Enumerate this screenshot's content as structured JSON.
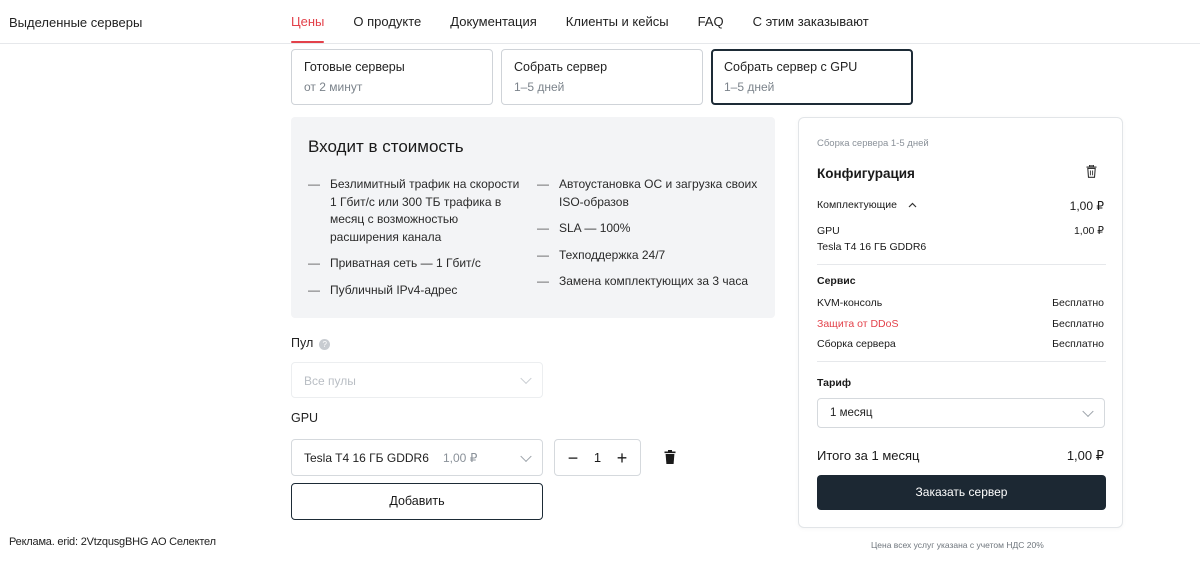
{
  "header": {
    "brand": "Выделенные серверы",
    "nav": [
      "Цены",
      "О продукте",
      "Документация",
      "Клиенты и кейсы",
      "FAQ",
      "С этим заказывают"
    ],
    "active_color": "#e3414a"
  },
  "server_types": [
    {
      "title": "Готовые серверы",
      "subtitle": "от 2 минут"
    },
    {
      "title": "Собрать сервер",
      "subtitle": "1–5 дней"
    },
    {
      "title": "Собрать сервер с GPU",
      "subtitle": "1–5 дней",
      "selected": true
    }
  ],
  "included": {
    "title": "Входит в стоимость",
    "left": [
      "Безлимитный трафик на скорости 1 Гбит/с или 300 ТБ трафика в месяц с возможностью расширения канала",
      "Приватная сеть — 1 Гбит/с",
      "Публичный IPv4-адрес"
    ],
    "right": [
      "Автоустановка ОС и загрузка своих ISO-образов",
      "SLA — 100%",
      "Техподдержка 24/7",
      "Замена комплектующих за 3 часа"
    ]
  },
  "form": {
    "pool_label": "Пул",
    "pool_placeholder": "Все пулы",
    "gpu_label": "GPU",
    "gpu_name": "Tesla T4 16 ГБ GDDR6",
    "gpu_price": "1,00 ₽",
    "quantity": "1",
    "add_label": "Добавить"
  },
  "summary": {
    "note": "Сборка сервера 1-5 дней",
    "title": "Конфигурация",
    "components_label": "Комплектующие",
    "components_price": "1,00 ₽",
    "gpu_label": "GPU",
    "gpu_price": "1,00 ₽",
    "gpu_name": "Tesla T4 16 ГБ GDDR6",
    "service_label": "Сервис",
    "services": [
      {
        "name": "KVM-консоль",
        "value": "Бесплатно"
      },
      {
        "name": "Защита от DDoS",
        "value": "Бесплатно",
        "highlight": true
      },
      {
        "name": "Сборка сервера",
        "value": "Бесплатно"
      }
    ],
    "tariff_label": "Тариф",
    "tariff_value": "1 месяц",
    "total_label": "Итого за 1 месяц",
    "total_value": "1,00 ₽",
    "order_label": "Заказать сервер",
    "vat_note": "Цена всех услуг указана с учетом НДС 20%"
  },
  "ad": "Реклама. erid: 2VtzqusgBHG АО Селектел"
}
